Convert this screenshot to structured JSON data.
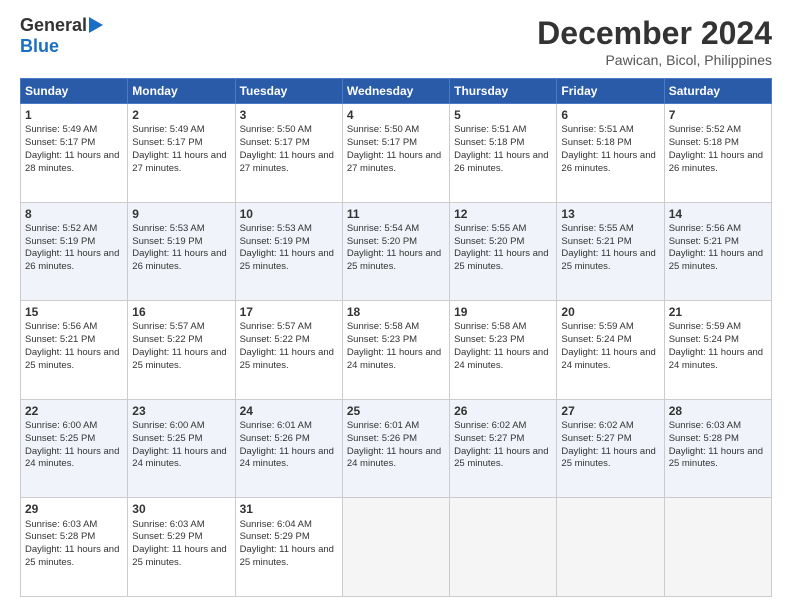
{
  "logo": {
    "general": "General",
    "blue": "Blue"
  },
  "title": "December 2024",
  "subtitle": "Pawican, Bicol, Philippines",
  "days": [
    "Sunday",
    "Monday",
    "Tuesday",
    "Wednesday",
    "Thursday",
    "Friday",
    "Saturday"
  ],
  "weeks": [
    [
      {
        "day": "1",
        "sunrise": "5:49 AM",
        "sunset": "5:17 PM",
        "daylight": "11 hours and 28 minutes."
      },
      {
        "day": "2",
        "sunrise": "5:49 AM",
        "sunset": "5:17 PM",
        "daylight": "11 hours and 27 minutes."
      },
      {
        "day": "3",
        "sunrise": "5:50 AM",
        "sunset": "5:17 PM",
        "daylight": "11 hours and 27 minutes."
      },
      {
        "day": "4",
        "sunrise": "5:50 AM",
        "sunset": "5:17 PM",
        "daylight": "11 hours and 27 minutes."
      },
      {
        "day": "5",
        "sunrise": "5:51 AM",
        "sunset": "5:18 PM",
        "daylight": "11 hours and 26 minutes."
      },
      {
        "day": "6",
        "sunrise": "5:51 AM",
        "sunset": "5:18 PM",
        "daylight": "11 hours and 26 minutes."
      },
      {
        "day": "7",
        "sunrise": "5:52 AM",
        "sunset": "5:18 PM",
        "daylight": "11 hours and 26 minutes."
      }
    ],
    [
      {
        "day": "8",
        "sunrise": "5:52 AM",
        "sunset": "5:19 PM",
        "daylight": "11 hours and 26 minutes."
      },
      {
        "day": "9",
        "sunrise": "5:53 AM",
        "sunset": "5:19 PM",
        "daylight": "11 hours and 26 minutes."
      },
      {
        "day": "10",
        "sunrise": "5:53 AM",
        "sunset": "5:19 PM",
        "daylight": "11 hours and 25 minutes."
      },
      {
        "day": "11",
        "sunrise": "5:54 AM",
        "sunset": "5:20 PM",
        "daylight": "11 hours and 25 minutes."
      },
      {
        "day": "12",
        "sunrise": "5:55 AM",
        "sunset": "5:20 PM",
        "daylight": "11 hours and 25 minutes."
      },
      {
        "day": "13",
        "sunrise": "5:55 AM",
        "sunset": "5:21 PM",
        "daylight": "11 hours and 25 minutes."
      },
      {
        "day": "14",
        "sunrise": "5:56 AM",
        "sunset": "5:21 PM",
        "daylight": "11 hours and 25 minutes."
      }
    ],
    [
      {
        "day": "15",
        "sunrise": "5:56 AM",
        "sunset": "5:21 PM",
        "daylight": "11 hours and 25 minutes."
      },
      {
        "day": "16",
        "sunrise": "5:57 AM",
        "sunset": "5:22 PM",
        "daylight": "11 hours and 25 minutes."
      },
      {
        "day": "17",
        "sunrise": "5:57 AM",
        "sunset": "5:22 PM",
        "daylight": "11 hours and 25 minutes."
      },
      {
        "day": "18",
        "sunrise": "5:58 AM",
        "sunset": "5:23 PM",
        "daylight": "11 hours and 24 minutes."
      },
      {
        "day": "19",
        "sunrise": "5:58 AM",
        "sunset": "5:23 PM",
        "daylight": "11 hours and 24 minutes."
      },
      {
        "day": "20",
        "sunrise": "5:59 AM",
        "sunset": "5:24 PM",
        "daylight": "11 hours and 24 minutes."
      },
      {
        "day": "21",
        "sunrise": "5:59 AM",
        "sunset": "5:24 PM",
        "daylight": "11 hours and 24 minutes."
      }
    ],
    [
      {
        "day": "22",
        "sunrise": "6:00 AM",
        "sunset": "5:25 PM",
        "daylight": "11 hours and 24 minutes."
      },
      {
        "day": "23",
        "sunrise": "6:00 AM",
        "sunset": "5:25 PM",
        "daylight": "11 hours and 24 minutes."
      },
      {
        "day": "24",
        "sunrise": "6:01 AM",
        "sunset": "5:26 PM",
        "daylight": "11 hours and 24 minutes."
      },
      {
        "day": "25",
        "sunrise": "6:01 AM",
        "sunset": "5:26 PM",
        "daylight": "11 hours and 24 minutes."
      },
      {
        "day": "26",
        "sunrise": "6:02 AM",
        "sunset": "5:27 PM",
        "daylight": "11 hours and 25 minutes."
      },
      {
        "day": "27",
        "sunrise": "6:02 AM",
        "sunset": "5:27 PM",
        "daylight": "11 hours and 25 minutes."
      },
      {
        "day": "28",
        "sunrise": "6:03 AM",
        "sunset": "5:28 PM",
        "daylight": "11 hours and 25 minutes."
      }
    ],
    [
      {
        "day": "29",
        "sunrise": "6:03 AM",
        "sunset": "5:28 PM",
        "daylight": "11 hours and 25 minutes."
      },
      {
        "day": "30",
        "sunrise": "6:03 AM",
        "sunset": "5:29 PM",
        "daylight": "11 hours and 25 minutes."
      },
      {
        "day": "31",
        "sunrise": "6:04 AM",
        "sunset": "5:29 PM",
        "daylight": "11 hours and 25 minutes."
      },
      null,
      null,
      null,
      null
    ]
  ]
}
